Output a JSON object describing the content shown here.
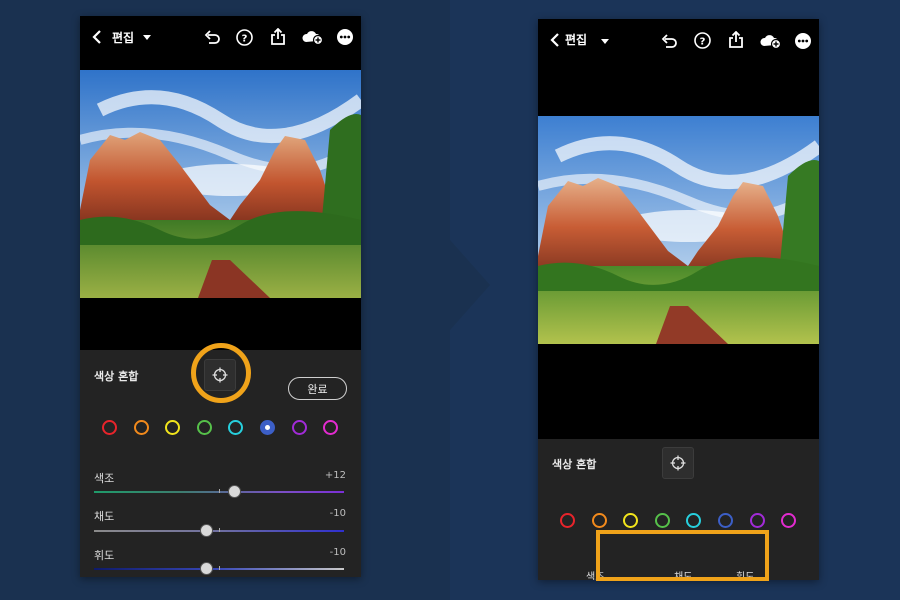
{
  "colors": {
    "accent_highlight": "#f0a31a",
    "background_left": "#1a3150",
    "background_right": "#1b3458",
    "panel": "#232323",
    "swatches": [
      "#e8242b",
      "#f28a1c",
      "#f2e51c",
      "#56c14a",
      "#27d0de",
      "#3c5fc7",
      "#a22bd8",
      "#e32bd0"
    ]
  },
  "left_screen": {
    "header": {
      "back_icon": "chevron-left-icon",
      "title": "편집",
      "dropdown_icon": "caret-down-icon",
      "icons": [
        "undo-icon",
        "help-icon",
        "share-icon",
        "cloud-add-icon",
        "more-icon"
      ]
    },
    "panel": {
      "title": "색상 혼합",
      "target_icon": "target-adjust-icon",
      "done_label": "완료",
      "selected_swatch_index": 5,
      "sliders": [
        {
          "label": "색조",
          "value": "+12",
          "level": 0.56
        },
        {
          "label": "채도",
          "value": "-10",
          "level": 0.45
        },
        {
          "label": "휘도",
          "value": "-10",
          "level": 0.45
        }
      ]
    }
  },
  "right_screen": {
    "header": {
      "back_icon": "chevron-left-icon",
      "title": "편집",
      "dropdown_icon": "caret-down-icon",
      "icons": [
        "undo-icon",
        "help-icon",
        "share-icon",
        "cloud-add-icon",
        "more-icon"
      ]
    },
    "panel": {
      "title": "색상 혼합",
      "target_icon": "target-adjust-icon",
      "tabs": [
        {
          "label": "색조",
          "active": false
        },
        {
          "label": "채도",
          "active": true
        },
        {
          "label": "휘도",
          "active": false
        }
      ]
    }
  }
}
